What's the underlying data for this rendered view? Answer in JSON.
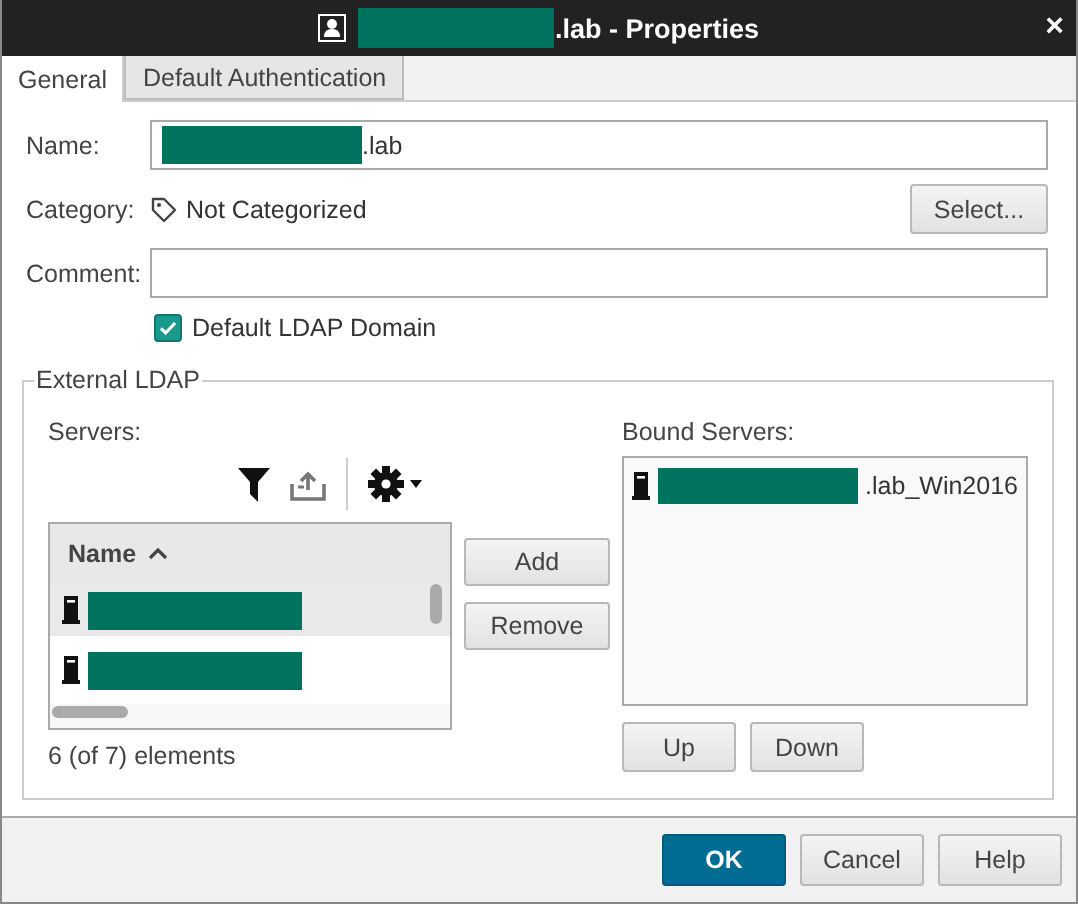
{
  "window": {
    "title": {
      "redacted_prefix": true,
      "text": ".lab - Properties"
    },
    "close": "×"
  },
  "tabs": [
    {
      "label": "General",
      "selected": true
    },
    {
      "label": "Default Authentication",
      "selected": false
    }
  ],
  "name_field": {
    "label": "Name:",
    "value": {
      "redacted_prefix": true,
      "text": ".lab"
    }
  },
  "category": {
    "label": "Category:",
    "value": "Not Categorized",
    "button": {
      "label": "Select..."
    }
  },
  "comment_field": {
    "label": "Comment:"
  },
  "default_ldap": {
    "label": "Default LDAP Domain",
    "checked": true
  },
  "external_ldap": {
    "title": "External LDAP",
    "servers": {
      "label": "Servers:",
      "column": "Name",
      "sort_ascending": true,
      "count": "6 (of 7) elements",
      "rows": [
        {
          "redacted": true,
          "selected": true
        },
        {
          "redacted": true,
          "selected": false
        }
      ]
    },
    "add": {
      "label": "Add"
    },
    "remove": {
      "label": "Remove"
    },
    "bound": {
      "label": "Bound Servers:",
      "rows": [
        {
          "redacted_prefix": true,
          "text": ".lab_Win2016"
        }
      ]
    },
    "up": {
      "label": "Up"
    },
    "down": {
      "label": "Down"
    }
  },
  "buttons": [
    {
      "label": "OK",
      "kind": "primary"
    },
    {
      "label": "Cancel",
      "kind": "normal"
    },
    {
      "label": "Help",
      "kind": "normal"
    }
  ]
}
